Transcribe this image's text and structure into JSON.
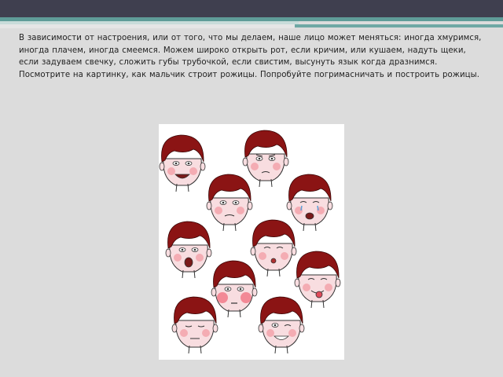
{
  "slide": {
    "paragraph": "В зависимости от настроения, или от того, что мы делаем, наше лицо может меняться: иногда хмуримся, иногда плачем,   иногда смеемся. Можем широко открыть рот, если кричим, или кушаем, надуть щеки, если задуваем свечку, сложить губы трубочкой,  если свистим, высунуть язык когда дразнимся. Посмотрите на картинку, как мальчик строит рожицы.  Попробуйте погримасничать и построить рожицы."
  },
  "picture": {
    "faces": [
      "smiling",
      "frowning",
      "surprised",
      "crying",
      "shouting",
      "whistling",
      "teasing",
      "puffed-cheeks",
      "eyes-closed",
      "winking"
    ]
  },
  "colors": {
    "header_bar": "#3f3f4f",
    "accent_teal": "#5f9c98",
    "background": "#dcdcdc",
    "hair": "#8b1414",
    "skin": "#f8dde0"
  }
}
